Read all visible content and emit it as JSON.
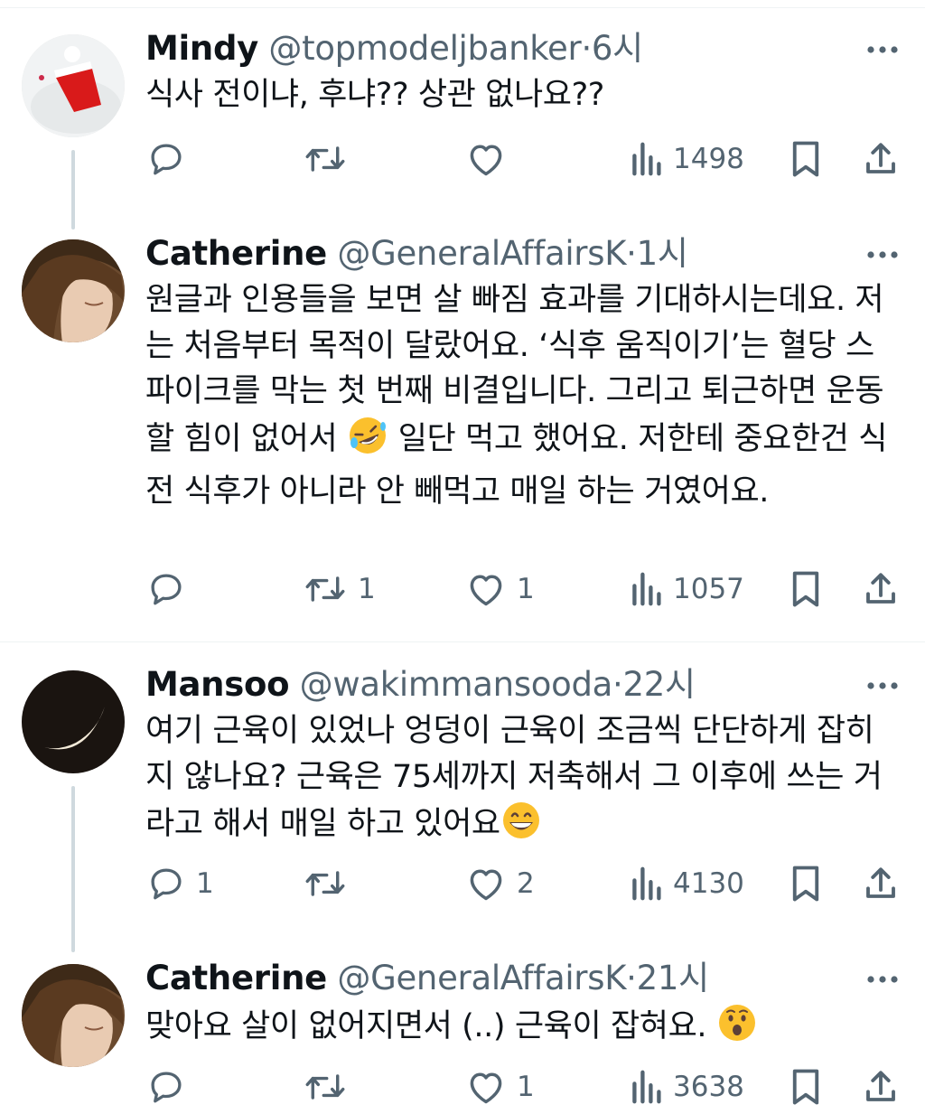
{
  "tweets": [
    {
      "name": "Mindy",
      "handle": "@topmodeljbanker",
      "time": "6시",
      "text": "식사 전이냐, 후냐?? 상관 없나요??",
      "replies": "",
      "retweets": "",
      "likes": "",
      "views": "1498"
    },
    {
      "name": "Catherine",
      "handle": "@GeneralAffairsK",
      "time": "1시",
      "text_a": "원글과 인용들을 보면 살 빠짐 효과를 기대하시는데요. 저는 처음부터 목적이 달랐어요. ‘식후 움직이기’는 혈당 스파이크를 막는 첫 번째 비결입니다. 그리고 퇴근하면 운동할 힘이 없어서 ",
      "text_b": " 일단 먹고 했어요. 저한테 중요한건 식전 식후가 아니라 안 빼먹고 매일 하는 거였어요.",
      "replies": "",
      "retweets": "1",
      "likes": "1",
      "views": "1057"
    },
    {
      "name": "Mansoo",
      "handle": "@wakimmansooda",
      "time": "22시",
      "text": "여기 근육이 있었나 엉덩이 근육이 조금씩 단단하게 잡히지 않나요? 근육은 75세까지 저축해서 그 이후에 쓰는 거라고 해서 매일 하고 있어요",
      "replies": "1",
      "retweets": "",
      "likes": "2",
      "views": "4130"
    },
    {
      "name": "Catherine",
      "handle": "@GeneralAffairsK",
      "time": "21시",
      "text": "맞아요 살이 없어지면서 (..) 근육이 잡혀요. ",
      "replies": "",
      "retweets": "",
      "likes": "1",
      "views": "3638"
    }
  ],
  "sep": "·",
  "icons": [
    "more-icon",
    "reply-icon",
    "retweet-icon",
    "like-icon",
    "views-icon",
    "bookmark-icon",
    "share-icon",
    "rofl-emoji",
    "grin-emoji",
    "surprised-emoji"
  ],
  "colors": {
    "text": "#0f1419",
    "secondary": "#536471",
    "line": "#cfd9de"
  }
}
